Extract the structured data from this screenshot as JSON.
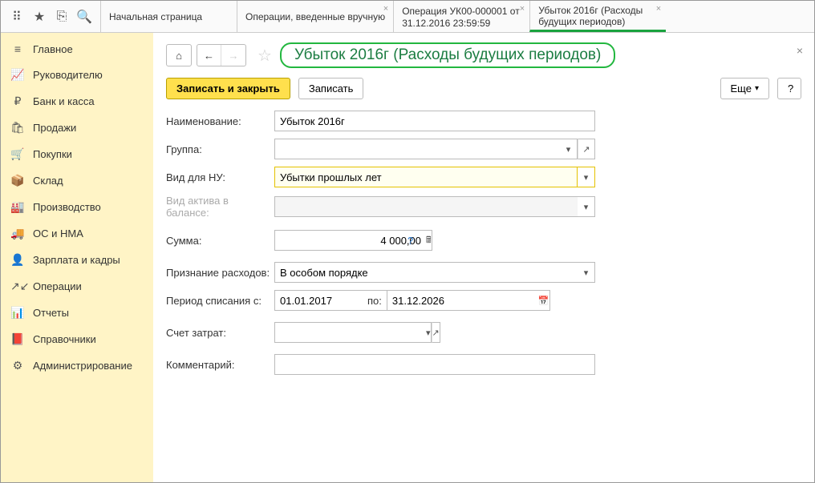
{
  "topbar": {
    "tabs": [
      {
        "line1": "Начальная страница",
        "line2": ""
      },
      {
        "line1": "Операции, введенные вручную",
        "line2": ""
      },
      {
        "line1": "Операция УК00-000001 от",
        "line2": "31.12.2016 23:59:59"
      },
      {
        "line1": "Убыток 2016г (Расходы",
        "line2": "будущих периодов)"
      }
    ]
  },
  "sidebar": {
    "items": [
      {
        "label": "Главное",
        "icon": "≡"
      },
      {
        "label": "Руководителю",
        "icon": "📈"
      },
      {
        "label": "Банк и касса",
        "icon": "₽"
      },
      {
        "label": "Продажи",
        "icon": "🛍"
      },
      {
        "label": "Покупки",
        "icon": "🛒"
      },
      {
        "label": "Склад",
        "icon": "📦"
      },
      {
        "label": "Производство",
        "icon": "🏭"
      },
      {
        "label": "ОС и НМА",
        "icon": "🚚"
      },
      {
        "label": "Зарплата и кадры",
        "icon": "👤"
      },
      {
        "label": "Операции",
        "icon": "↗↙"
      },
      {
        "label": "Отчеты",
        "icon": "📊"
      },
      {
        "label": "Справочники",
        "icon": "📕"
      },
      {
        "label": "Администрирование",
        "icon": "⚙"
      }
    ]
  },
  "header": {
    "title": "Убыток 2016г (Расходы будущих периодов)"
  },
  "actions": {
    "save_close": "Записать и закрыть",
    "save": "Записать",
    "more": "Еще",
    "help": "?"
  },
  "form": {
    "name_label": "Наименование:",
    "name_value": "Убыток 2016г",
    "group_label": "Группа:",
    "group_value": "",
    "type_label": "Вид для НУ:",
    "type_value": "Убытки прошлых лет",
    "asset_label": "Вид актива в балансе:",
    "asset_value": "",
    "sum_label": "Сумма:",
    "sum_value": "4 000,00",
    "recog_label": "Признание расходов:",
    "recog_value": "В особом порядке",
    "period_label": "Период списания с:",
    "period_from": "01.01.2017",
    "period_to_label": "по:",
    "period_to": "31.12.2026",
    "account_label": "Счет затрат:",
    "account_value": "",
    "comment_label": "Комментарий:",
    "comment_value": ""
  }
}
